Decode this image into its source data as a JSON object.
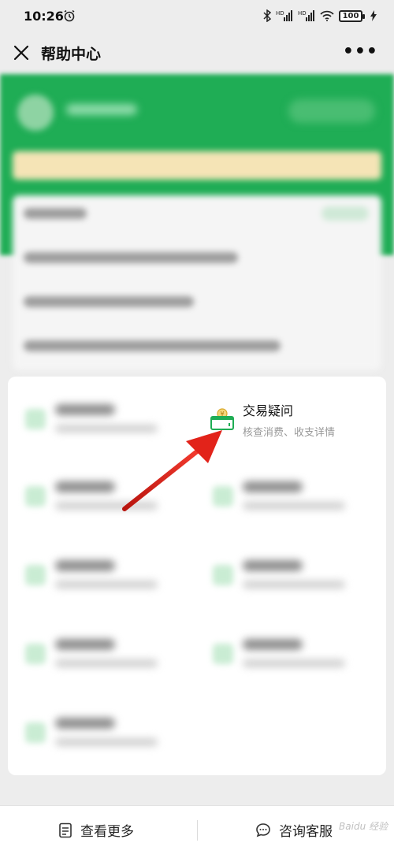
{
  "status": {
    "time": "10:26",
    "battery": "100"
  },
  "titlebar": {
    "title": "帮助中心",
    "more": "•••"
  },
  "service": {
    "name": "交易疑问",
    "desc": "核查消费、收支详情"
  },
  "bottom": {
    "more_label": "查看更多",
    "service_label": "咨询客服"
  },
  "watermark": "Baidu 经验",
  "colors": {
    "brand_green": "#1fad55",
    "arrow_red": "#e2231a",
    "background": "#ededed"
  }
}
